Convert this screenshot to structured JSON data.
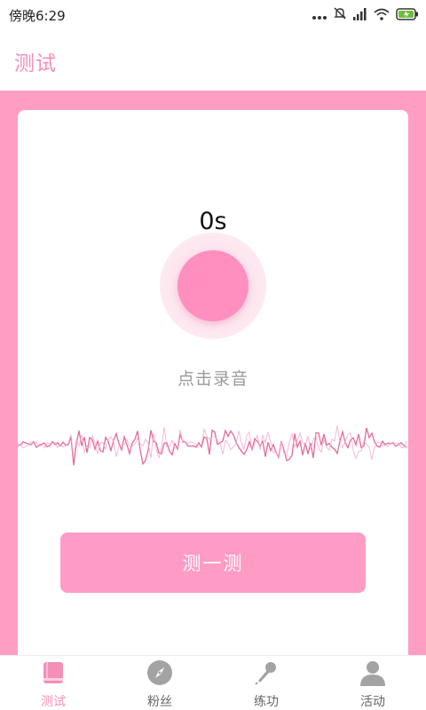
{
  "status_bar": {
    "time": "傍晚6:29",
    "icons": [
      "more-dots-icon",
      "alarm-off-icon",
      "signal-icon",
      "wifi-icon",
      "battery-charging-icon"
    ]
  },
  "header": {
    "title": "测试"
  },
  "recorder": {
    "timer": "0s",
    "record_label": "点击录音",
    "test_button_label": "测一测"
  },
  "colors": {
    "accent": "#ff9dc3",
    "title_pink": "#f48fb8",
    "record_button": "#ff8fbe",
    "waveform": "#e46a9c"
  },
  "tab_bar": {
    "tabs": [
      {
        "label": "测试",
        "icon": "book-icon",
        "active": true
      },
      {
        "label": "粉丝",
        "icon": "compass-icon",
        "active": false
      },
      {
        "label": "练功",
        "icon": "microphone-icon",
        "active": false
      },
      {
        "label": "活动",
        "icon": "person-icon",
        "active": false
      }
    ]
  }
}
